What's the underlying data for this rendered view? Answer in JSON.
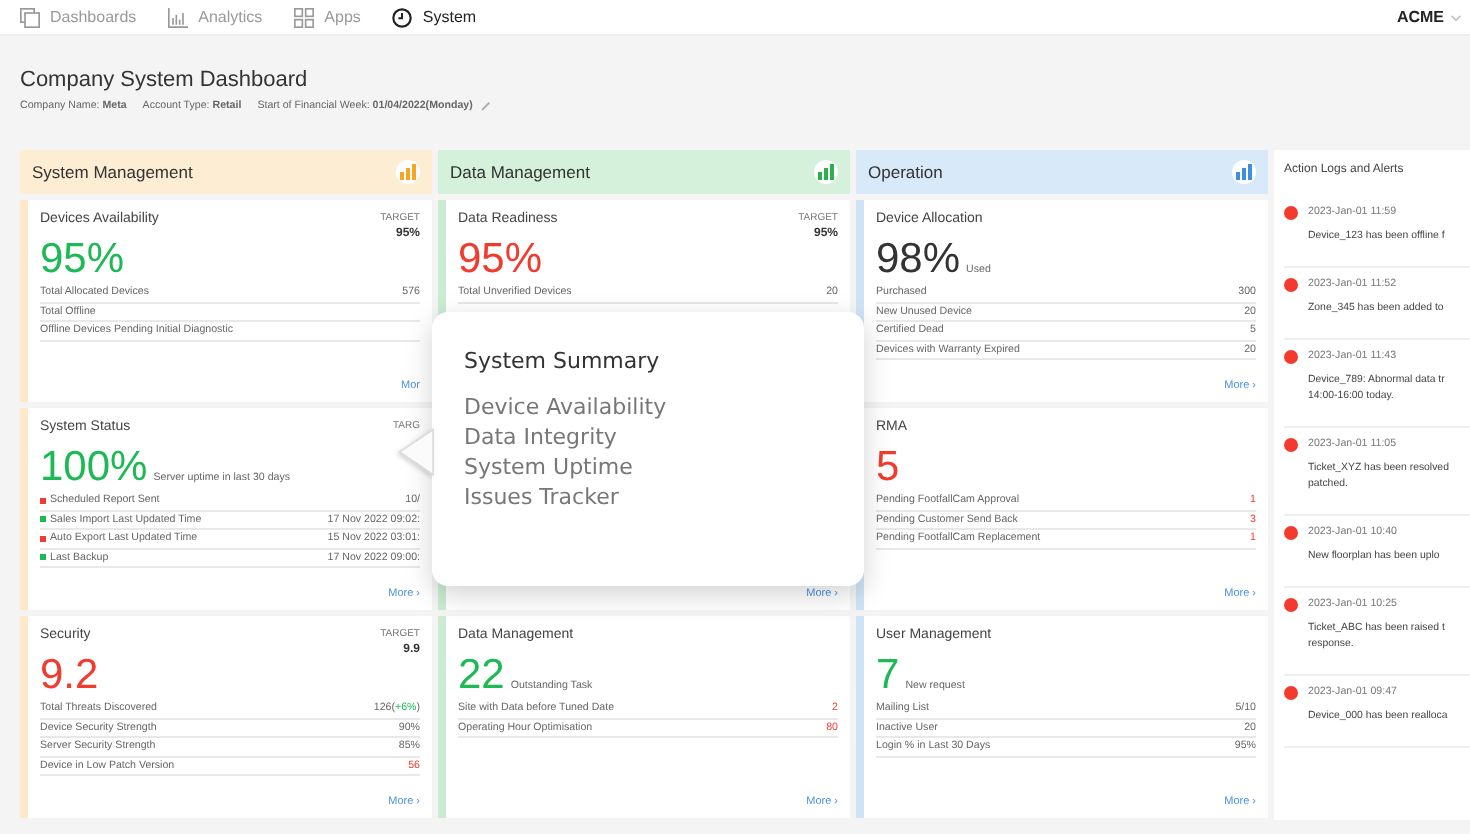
{
  "nav": {
    "tabs": [
      {
        "label": "Dashboards",
        "selected": false
      },
      {
        "label": "Analytics",
        "selected": false
      },
      {
        "label": "Apps",
        "selected": false
      },
      {
        "label": "System",
        "selected": true
      }
    ],
    "account": "ACME"
  },
  "page": {
    "title": "Company System Dashboard",
    "meta": [
      "Company Name: **Meta**",
      "Account Type: **Retail**",
      "Start of Financial Week: **01/04/2022(Monday)**"
    ]
  },
  "columns": [
    {
      "title": "System Management",
      "color": "#f5a623",
      "cards": [
        {
          "title": "Devices Availability",
          "target_label": "TARGET",
          "target": "95%",
          "value": "95%",
          "color": "#1db954",
          "rows": [
            {
              "label": "Total Allocated Devices",
              "value": "576",
              "alert": false
            },
            {
              "label": "Total Offline"
            },
            {
              "label": "Offline Devices Pending Initial Diagnostic"
            }
          ],
          "more": "Mor"
        },
        {
          "title": "System Status",
          "target_label": "TARG",
          "value": "100%",
          "color": "#1db954",
          "caption": "Server uptime in last 30 days",
          "rows": [
            {
              "label": "Scheduled Report Sent",
              "value": "10/",
              "alert": false,
              "color": "#f23a2e"
            },
            {
              "label": "Sales Import Last Updated Time",
              "value": "17 Nov 2022 09:02:",
              "alert": false,
              "color": "#1db954"
            },
            {
              "label": "Auto Export Last Updated Time",
              "value": "15 Nov 2022 03:01:",
              "alert": false,
              "color": "#f23a2e"
            },
            {
              "label": "Last Backup",
              "value": "17 Nov 2022 09:00:",
              "alert": false,
              "color": "#1db954"
            }
          ],
          "more": "More ›"
        },
        {
          "title": "Security",
          "target_label": "TARGET",
          "target": "9.9",
          "value": "9.2",
          "color": "#f23a2e",
          "rows": [
            {
              "label": "Total Threats Discovered",
              "value": "126(",
              "change": "+6%",
              "value_end": ")",
              "alert": false
            },
            {
              "label": "Device Security Strength",
              "value": "90%",
              "alert": false
            },
            {
              "label": "Server Security Strength",
              "value": "85%",
              "alert": false
            },
            {
              "label": "Device in Low Patch Version",
              "value": "56",
              "alert": true
            }
          ],
          "more": "More ›"
        }
      ]
    },
    {
      "title": "Data Management",
      "color": "#2bb24c",
      "cards": [
        {
          "title": "Data Readiness",
          "target_label": "TARGET",
          "target": "95%",
          "value": "95%",
          "color": "#f23a2e",
          "rows": [
            {
              "label": "Total Unverified Devices",
              "value": "20",
              "alert": false
            }
          ]
        },
        {
          "more": "More ›"
        },
        {
          "title": "Data Management",
          "value": "22",
          "color": "#1db954",
          "caption": "Outstanding Task",
          "rows": [
            {
              "label": "Site with Data before Tuned Date",
              "value": "2",
              "alert": true
            },
            {
              "label": "Operating Hour Optimisation",
              "value": "80",
              "alert": true
            }
          ],
          "more": "More ›"
        }
      ]
    },
    {
      "title": "Operation",
      "color": "#3d8fe0",
      "cards": [
        {
          "title": "Device Allocation",
          "value": "98%",
          "color": "#333333",
          "caption": "Used",
          "rows": [
            {
              "label": "Purchased",
              "value": "300",
              "alert": false
            },
            {
              "label": "New Unused Device",
              "value": "20",
              "alert": false
            },
            {
              "label": "Certified Dead",
              "value": "5",
              "alert": false
            },
            {
              "label": "Devices with Warranty Expired",
              "value": "20",
              "alert": false
            }
          ],
          "more": "More ›"
        },
        {
          "title": "RMA",
          "value": "5",
          "color": "#f23a2e",
          "rows": [
            {
              "label": "Pending FootfallCam Approval",
              "value": "1",
              "alert": true
            },
            {
              "label": "Pending Customer Send Back",
              "value": "3",
              "alert": true
            },
            {
              "label": "Pending FootfallCam Replacement",
              "value": "1",
              "alert": true
            }
          ],
          "more": "More ›"
        },
        {
          "title": "User Management",
          "value": "7",
          "color": "#1db954",
          "caption": "New request",
          "rows": [
            {
              "label": "Mailing List",
              "value": "5/10",
              "alert": false
            },
            {
              "label": "Inactive User",
              "value": "20",
              "alert": false
            },
            {
              "label": "Login % in Last 30 Days",
              "value": "95%",
              "alert": false
            }
          ],
          "more": "More ›"
        }
      ]
    }
  ],
  "popover": {
    "title": "System Summary",
    "items": [
      "Device Availability",
      "Data Integrity",
      "System Uptime",
      "Issues Tracker"
    ]
  },
  "logs": {
    "title": "Action Logs and Alerts",
    "entries": [
      {
        "time": "2023-Jan-01 11:59",
        "message": [
          "Device_123 has been offline f"
        ]
      },
      {
        "time": "2023-Jan-01 11:52",
        "message": [
          "Zone_345 has been added to"
        ]
      },
      {
        "time": "2023-Jan-01 11:43",
        "message": [
          "Device_789: Abnormal data tr",
          "14:00-16:00 today."
        ]
      },
      {
        "time": "2023-Jan-01 11:05",
        "message": [
          "Ticket_XYZ has been resolved",
          "patched."
        ]
      },
      {
        "time": "2023-Jan-01 10:40",
        "message": [
          "New floorplan has been uplo"
        ]
      },
      {
        "time": "2023-Jan-01 10:25",
        "message": [
          "Ticket_ABC has been raised t",
          "response."
        ]
      },
      {
        "time": "2023-Jan-01 09:47",
        "message": [
          "Device_000 has been realloca"
        ]
      }
    ]
  }
}
